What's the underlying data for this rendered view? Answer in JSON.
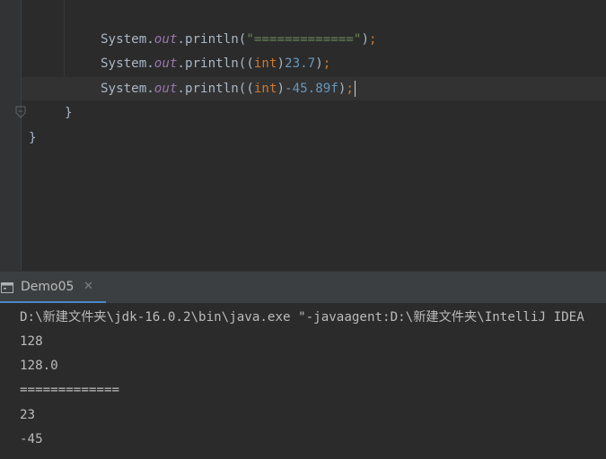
{
  "editor": {
    "lines": [
      {
        "receiver": "System",
        "dot1": ".",
        "field": "out",
        "dot2": ".",
        "method": "println(",
        "arg": "\"=============\"",
        "close": ")",
        "semi": ";"
      },
      {
        "receiver": "System",
        "dot1": ".",
        "field": "out",
        "dot2": ".",
        "method": "println(",
        "cast_open": "(",
        "cast_type": "int",
        "cast_close": ")",
        "num": "23.7",
        "close": ")",
        "semi": ";"
      },
      {
        "receiver": "System",
        "dot1": ".",
        "field": "out",
        "dot2": ".",
        "method": "println(",
        "cast_open": "(",
        "cast_type": "int",
        "cast_close": ")",
        "num": "-45.89f",
        "close": ")",
        "semi": ";"
      }
    ],
    "method_close_brace": "}",
    "class_close_brace": "}"
  },
  "run_panel": {
    "tab_label": "Demo05",
    "tab_close": "✕",
    "icon": "run-console-icon"
  },
  "console": {
    "lines": [
      "D:\\新建文件夹\\jdk-16.0.2\\bin\\java.exe \"-javaagent:D:\\新建文件夹\\IntelliJ IDEA",
      "128",
      "128.0",
      "=============",
      "23",
      "-45"
    ]
  },
  "colors": {
    "editor_bg": "#2b2b2b",
    "keyword": "#cc7832",
    "string": "#6a8759",
    "number": "#6897bb",
    "field": "#9876aa",
    "tab_underline": "#4a88c7"
  }
}
